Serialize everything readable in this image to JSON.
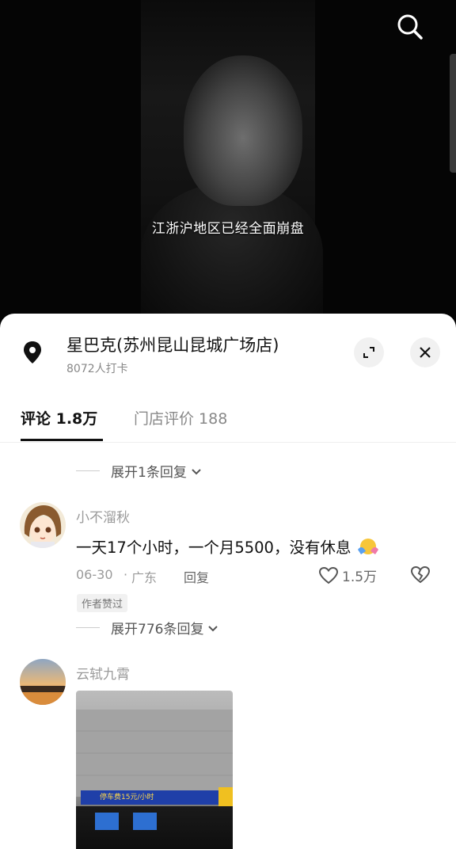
{
  "video": {
    "subtitle": "江浙沪地区已经全面崩盘"
  },
  "store": {
    "name": "星巴克(苏州昆山昆城广场店)",
    "checkins": "8072人打卡"
  },
  "tabs": [
    {
      "label": "评论 1.8万",
      "active": true
    },
    {
      "label": "门店评价 188",
      "active": false
    }
  ],
  "comments": [
    {
      "expand_label": "展开1条回复"
    },
    {
      "username": "小不溜秋",
      "text": "一天17个小时，一个月5500，没有休息",
      "date": "06-30",
      "location": "广东",
      "reply_label": "回复",
      "likes": "1.5万",
      "badge": "作者赞过",
      "expand_label": "展开776条回复"
    },
    {
      "username": "云轼九霄",
      "photo_sign_text": "停车费15元/小时"
    }
  ],
  "icons": {
    "search": "search-icon",
    "pin": "location-pin-icon",
    "expand": "expand-icon",
    "close": "close-icon",
    "heart": "heart-icon",
    "broken_heart": "broken-heart-icon",
    "chevron": "chevron-down-icon"
  },
  "colors": {
    "sheet_bg": "#ffffff",
    "primary_text": "#111111",
    "secondary_text": "#9a9a9a",
    "video_bg": "#050505"
  }
}
